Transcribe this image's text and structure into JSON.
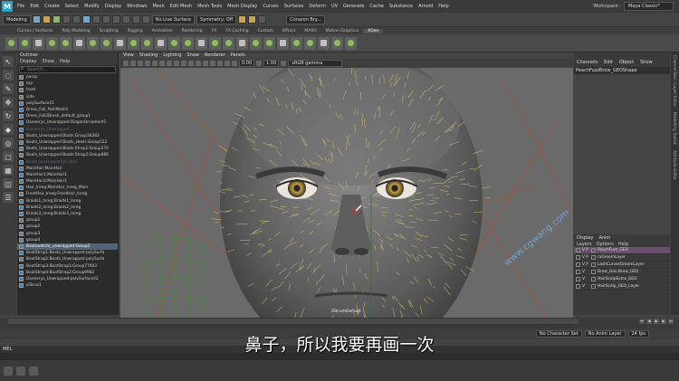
{
  "menubar": {
    "logo": "M",
    "items": [
      "File",
      "Edit",
      "Create",
      "Select",
      "Modify",
      "Display",
      "Windows",
      "Mesh",
      "Edit Mesh",
      "Mesh Tools",
      "Mesh Display",
      "Curves",
      "Surfaces",
      "Deform",
      "UV",
      "Generate",
      "Cache",
      "Substance",
      "Arnold",
      "Help"
    ],
    "workspace_label": "Workspace :",
    "workspace_value": "Maya Classic*"
  },
  "statusline": {
    "mode": "Modeling",
    "live_surface": "No Live Surface",
    "symmetry": "Symmetry: Off",
    "user": "Corazon Bry..."
  },
  "shelf_tabs": [
    "Curves / Surfaces",
    "Poly Modeling",
    "Sculpting",
    "Rigging",
    "Animation",
    "Rendering",
    "FX",
    "FX Caching",
    "Custom",
    "Bifrost",
    "MASH",
    "Motion Graphics",
    "XGen"
  ],
  "shelf_active": "XGen",
  "outliner": {
    "title": "Outliner",
    "menu": [
      "Display",
      "Show",
      "Help"
    ],
    "search_placeholder": "Search...",
    "rows": [
      {
        "label": "persp",
        "kind": "cam",
        "state": ""
      },
      {
        "label": "top",
        "kind": "cam",
        "state": ""
      },
      {
        "label": "front",
        "kind": "cam",
        "state": ""
      },
      {
        "label": "side",
        "kind": "cam",
        "state": ""
      },
      {
        "label": "polySurface11",
        "kind": "mesh",
        "state": ""
      },
      {
        "label": "Dress_Fall_Pall:Mesh1",
        "kind": "mesh",
        "state": ""
      },
      {
        "label": "Dress_Fall2Brush_default_group1",
        "kind": "mesh",
        "state": ""
      },
      {
        "label": "Daenerys_Unwrapped:DiagonOrnament1",
        "kind": "mesh",
        "state": ""
      },
      {
        "label": "Daenerys_Unwrapped:...",
        "kind": "mesh",
        "state": "dim"
      },
      {
        "label": "Boots_Unwrapped:Boots:Group34383",
        "kind": "grp",
        "state": ""
      },
      {
        "label": "Boots_Unwrapped:Boots_Heels:Group522",
        "kind": "grp",
        "state": ""
      },
      {
        "label": "Boots_Unwrapped:Boots:Strap1:Group270",
        "kind": "grp",
        "state": ""
      },
      {
        "label": "Boots_Unwrapped:Boots:Strap2:Group866",
        "kind": "grp",
        "state": ""
      },
      {
        "label": "Boots_Unwrapped:pCube1",
        "kind": "mesh",
        "state": "dim"
      },
      {
        "label": "MainHair:MainHair",
        "kind": "mesh",
        "state": ""
      },
      {
        "label": "MainHair1:MainHair1",
        "kind": "mesh",
        "state": ""
      },
      {
        "label": "MainHair2:MainHair1",
        "kind": "mesh",
        "state": ""
      },
      {
        "label": "Hair_Inreg:MainHair_Inreg_Main",
        "kind": "mesh",
        "state": ""
      },
      {
        "label": "FrontHair_Inreg:FrontHair_Inreg",
        "kind": "mesh",
        "state": ""
      },
      {
        "label": "Braids1_Inreg:Braids1_Inreg",
        "kind": "mesh",
        "state": ""
      },
      {
        "label": "Braids2_Inreg:Braids2_Inreg",
        "kind": "mesh",
        "state": ""
      },
      {
        "label": "Braids3_Inreg:Braids3_Inreg",
        "kind": "mesh",
        "state": ""
      },
      {
        "label": "group1",
        "kind": "grp",
        "state": ""
      },
      {
        "label": "group2",
        "kind": "grp",
        "state": ""
      },
      {
        "label": "group3",
        "kind": "grp",
        "state": ""
      },
      {
        "label": "group4",
        "kind": "grp",
        "state": ""
      },
      {
        "label": "Bootswatchr_unwrapped:Group2",
        "kind": "grp",
        "state": "sel"
      },
      {
        "label": "BootStrap1:Boots_Unwrapped:polySurfa",
        "kind": "mesh",
        "state": ""
      },
      {
        "label": "BootStrap2:Boots_Unwrapped:polySurfa",
        "kind": "mesh",
        "state": ""
      },
      {
        "label": "BootStrap3:BootStrap1:Group77003",
        "kind": "mesh",
        "state": ""
      },
      {
        "label": "BootStrap4:BootStrap2:Group9982",
        "kind": "mesh",
        "state": ""
      },
      {
        "label": "Daenerys_Unwrapped:polySurface42",
        "kind": "mesh",
        "state": ""
      },
      {
        "label": "pTorus1",
        "kind": "mesh",
        "state": ""
      }
    ]
  },
  "viewport": {
    "menu": [
      "View",
      "Shading",
      "Lighting",
      "Show",
      "Renderer",
      "Panels"
    ],
    "near_value": "0.00",
    "far_value": "1.00",
    "colorspace": "sRGB gamma",
    "camera_label": "ZBrushDefault"
  },
  "channel_box": {
    "menu": [
      "Channels",
      "Edit",
      "Object",
      "Show"
    ],
    "object_name": "PeachFuzzBrow_GEOShape"
  },
  "layer_editor": {
    "tabs": [
      "Display",
      "Anim"
    ],
    "menu": [
      "Layers",
      "Options",
      "Help"
    ],
    "layers": [
      {
        "label": "PeachFuzz_GEO",
        "flags": "V P",
        "selected": true
      },
      {
        "label": "raGroomLayer",
        "flags": "V P",
        "selected": false
      },
      {
        "label": "LashCurvesGroomLayer",
        "flags": "V P",
        "selected": false
      },
      {
        "label": "Brow_Geo:Brow_GEO",
        "flags": "V",
        "selected": false
      },
      {
        "label": "HairScalpExtra_GEO",
        "flags": "V",
        "selected": false
      },
      {
        "label": "HairScalp_GEO_Layer",
        "flags": "V",
        "selected": false
      }
    ]
  },
  "side_tabs": [
    "Channel Box / Layer Editor",
    "Modelling Toolkit",
    "Attribute Editor"
  ],
  "range": {
    "no_character_set": "No Character Set",
    "no_anim_layer": "No Anim Layer",
    "fps": "24 fps"
  },
  "command_line": {
    "label": "MEL"
  },
  "subtitle": "鼻子，所以我要再画一次",
  "watermark": "www.cgwang.com"
}
